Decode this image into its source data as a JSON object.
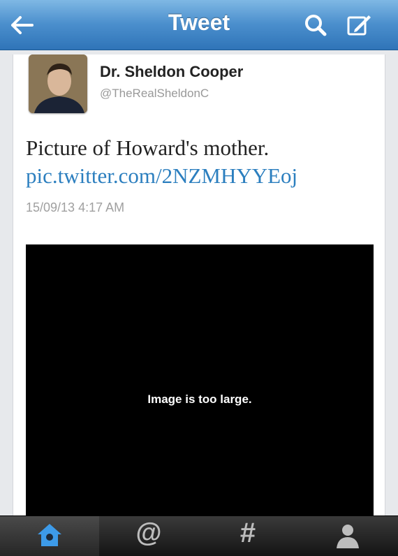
{
  "navbar": {
    "title": "Tweet"
  },
  "tweet": {
    "author_name": "Dr. Sheldon Cooper",
    "author_handle": "@TheRealSheldonC",
    "text": "Picture of Howard's mother.",
    "link": "pic.twitter.com/2NZMHYYEoj",
    "timestamp": "15/09/13 4:17 AM",
    "media_message": "Image is too large."
  },
  "tabs": [
    {
      "icon": "home-icon",
      "label": ""
    },
    {
      "icon": "mention-icon",
      "label": ""
    },
    {
      "icon": "discover-icon",
      "label": ""
    },
    {
      "icon": "profile-icon",
      "label": ""
    }
  ],
  "colors": {
    "nav_blue": "#4b8fcd",
    "link_blue": "#2c7fbf",
    "active_tab_icon": "#3d9be9"
  }
}
